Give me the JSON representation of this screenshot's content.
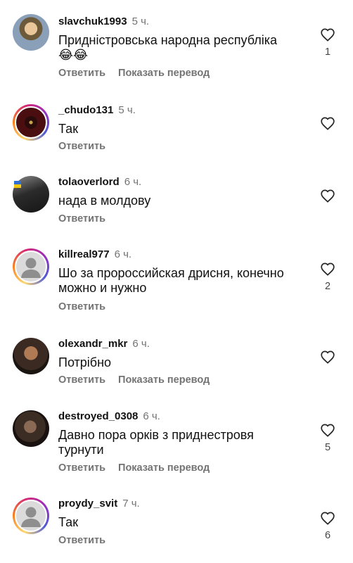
{
  "comments": [
    {
      "username": "slavchuk1993",
      "time": "5 ч.",
      "text": "Придністровська народна республіка😂😂",
      "reply_label": "Ответить",
      "translate_label": "Показать перевод",
      "likes": "1",
      "avatar": "photo-soldier-avatar"
    },
    {
      "username": "_chudo131",
      "time": "5 ч.",
      "text": "Так",
      "reply_label": "Ответить",
      "likes": "",
      "avatar": "emblem-avatar"
    },
    {
      "username": "tolaoverlord",
      "time": "6 ч.",
      "text": "нада в молдову",
      "reply_label": "Ответить",
      "likes": "",
      "avatar": "photo-avatar"
    },
    {
      "username": "killreal977",
      "time": "6 ч.",
      "text": "Шо за пророссийская дрисня, конечно можно и нужно",
      "reply_label": "Ответить",
      "likes": "2",
      "avatar": "default-user-avatar"
    },
    {
      "username": "olexandr_mkr",
      "time": "6 ч.",
      "text": "Потрібно",
      "reply_label": "Ответить",
      "translate_label": "Показать перевод",
      "likes": "",
      "avatar": "photo-avatar"
    },
    {
      "username": "destroyed_0308",
      "time": "6 ч.",
      "text": "Давно пора орків з приднестровя турнути",
      "reply_label": "Ответить",
      "translate_label": "Показать перевод",
      "likes": "5",
      "avatar": "photo-avatar"
    },
    {
      "username": "proydy_svit",
      "time": "7 ч.",
      "text": "Так",
      "reply_label": "Ответить",
      "likes": "6",
      "avatar": "default-user-avatar"
    }
  ],
  "icons": {
    "like": "heart-outline-icon"
  },
  "colors": {
    "secondary_text": "#737373",
    "story_ring_start": "#feda75",
    "story_ring_end": "#962fbf"
  }
}
